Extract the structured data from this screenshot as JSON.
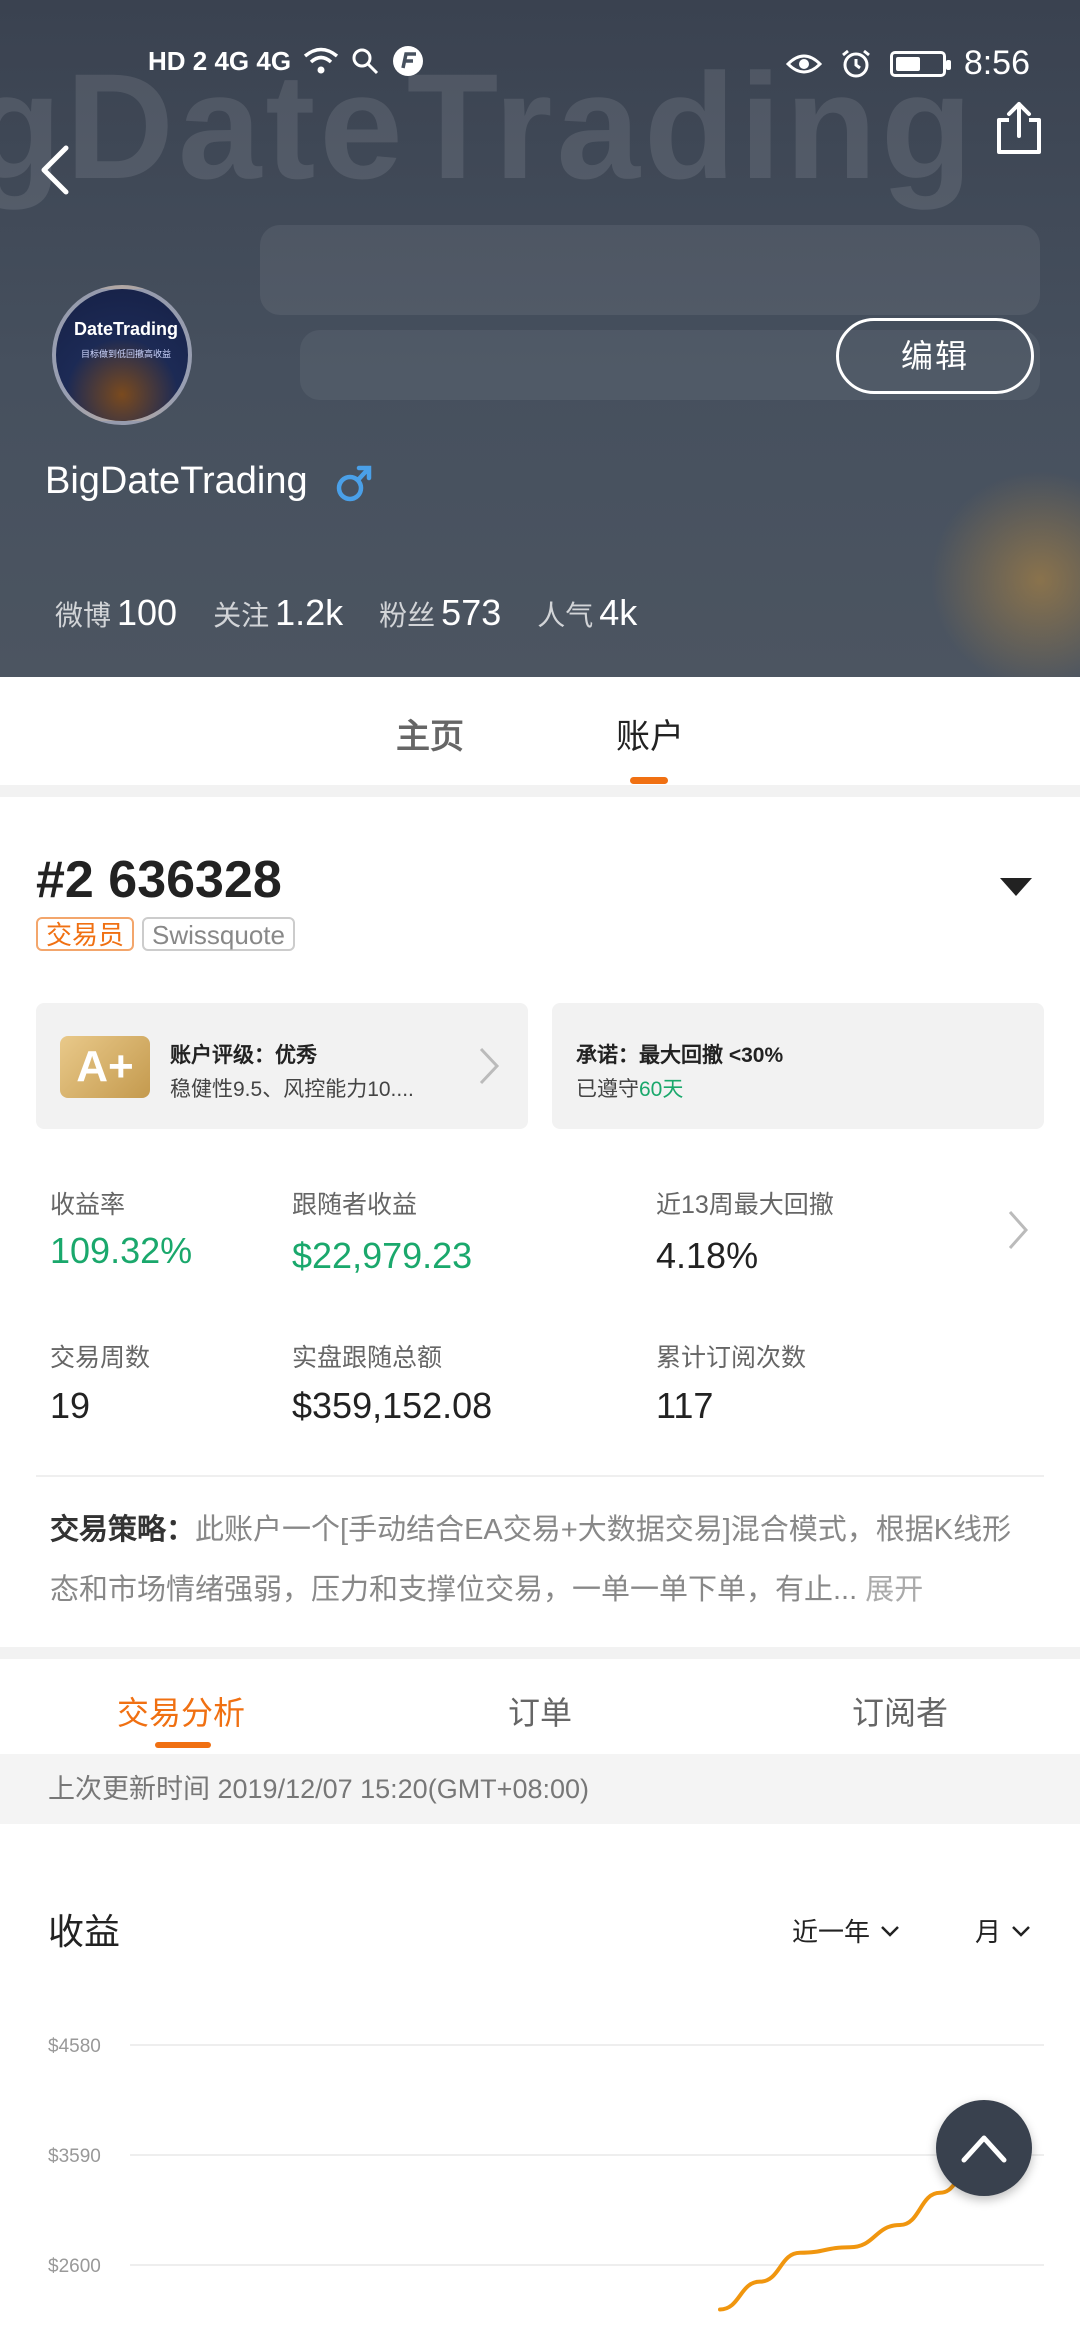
{
  "status_bar": {
    "left_label": "HD 2  4G  4G",
    "time": "8:56",
    "battery_level": 0.55
  },
  "profile": {
    "username": "BigDateTrading",
    "edit_label": "编辑",
    "avatar_title": "DateTrading",
    "avatar_subtitle": "目标做到低回撤高收益",
    "stats": [
      {
        "label": "微博",
        "value": "100"
      },
      {
        "label": "关注",
        "value": "1.2k"
      },
      {
        "label": "粉丝",
        "value": "573"
      },
      {
        "label": "人气",
        "value": "4k"
      }
    ]
  },
  "top_tabs": [
    "主页",
    "账户"
  ],
  "account": {
    "number": "#2 636328",
    "tag_trader": "交易员",
    "tag_broker": "Swissquote",
    "rating_badge": "A+",
    "rating_title": "账户评级：优秀",
    "rating_sub": "稳健性9.5、风控能力10....",
    "promise_title": "承诺：最大回撤 <30%",
    "promise_sub_prefix": "已遵守",
    "promise_days": "60天"
  },
  "metrics": [
    {
      "label": "收益率",
      "value": "109.32%"
    },
    {
      "label": "跟随者收益",
      "value": "$22,979.23"
    },
    {
      "label": "近13周最大回撤",
      "value": "4.18%"
    },
    {
      "label": "交易周数",
      "value": "19"
    },
    {
      "label": "实盘跟随总额",
      "value": "$359,152.08"
    },
    {
      "label": "累计订阅次数",
      "value": "117"
    }
  ],
  "strategy": {
    "label": "交易策略：",
    "text": "此账户一个[手动结合EA交易+大数据交易]混合模式，根据K线形态和市场情绪强弱，压力和支撑位交易，一单一单下单，有止...",
    "more": "展开"
  },
  "sub_tabs": [
    "交易分析",
    "订单",
    "订阅者"
  ],
  "update_time": "上次更新时间 2019/12/07 15:20(GMT+08:00)",
  "chart_section": {
    "title": "收益",
    "range_label": "近一年",
    "period_label": "月"
  },
  "chart_data": {
    "type": "line",
    "title": "收益",
    "y_ticks": [
      "$4580",
      "$3590",
      "$2600"
    ],
    "ylim": [
      2200,
      4580
    ],
    "grid": true,
    "series": [
      {
        "values": [
          2200,
          2450,
          2710,
          2760,
          2960,
          3250,
          3420,
          3460
        ]
      }
    ],
    "color": "#f0960f"
  },
  "colors": {
    "accent": "#f07012",
    "positive": "#1aa86c",
    "line": "#f0960f"
  }
}
